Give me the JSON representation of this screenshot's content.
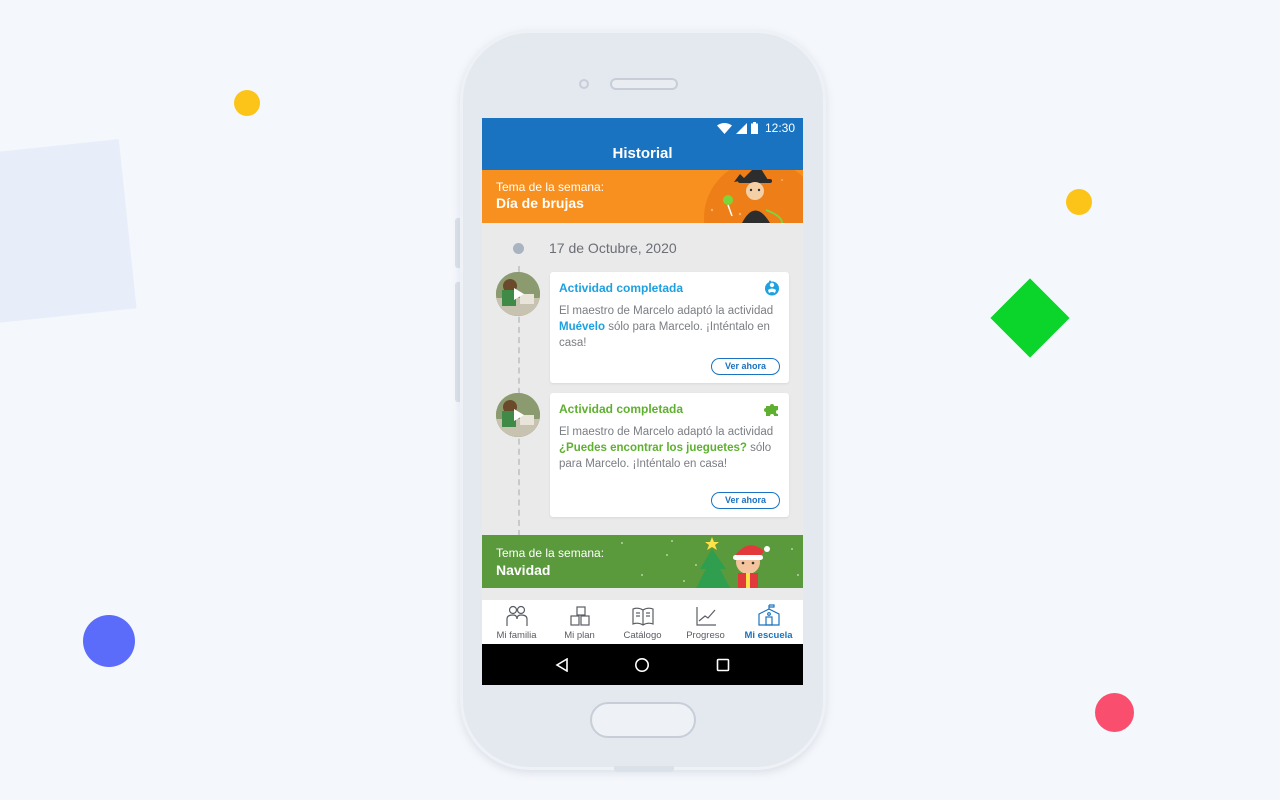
{
  "status_bar": {
    "time": "12:30"
  },
  "app_bar": {
    "title": "Historial"
  },
  "banner_top": {
    "label": "Tema de la semana:",
    "title": "Día de brujas"
  },
  "timeline": {
    "date": "17 de Octubre, 2020"
  },
  "cards": [
    {
      "title": "Actividad completada",
      "icon": "baby-icon",
      "body_before": "El maestro de Marcelo adaptó la actividad ",
      "highlight": "Muévelo",
      "body_after": " sólo para Marcelo. ¡Inténtalo en casa!",
      "button": "Ver ahora",
      "color": "#1da1e0"
    },
    {
      "title": "Actividad completada",
      "icon": "puzzle-icon",
      "body_before": "El maestro de Marcelo adaptó la actividad ",
      "highlight": "¿Puedes encontrar los jueguetes?",
      "body_after": " sólo para Marcelo. ¡Inténtalo en casa!",
      "button": "Ver ahora",
      "color": "#5fb030"
    }
  ],
  "banner_bottom": {
    "label": "Tema de la semana:",
    "title": "Navidad"
  },
  "bottom_nav": [
    {
      "label": "Mi familia",
      "icon": "family-icon",
      "active": false
    },
    {
      "label": "Mi plan",
      "icon": "blocks-icon",
      "active": false
    },
    {
      "label": "Catálogo",
      "icon": "book-icon",
      "active": false
    },
    {
      "label": "Progreso",
      "icon": "chart-icon",
      "active": false
    },
    {
      "label": "Mi escuela",
      "icon": "school-icon",
      "active": true
    }
  ],
  "colors": {
    "primary": "#1a73c0",
    "orange_banner": "#f7901e",
    "green_banner": "#5b9a3c"
  }
}
